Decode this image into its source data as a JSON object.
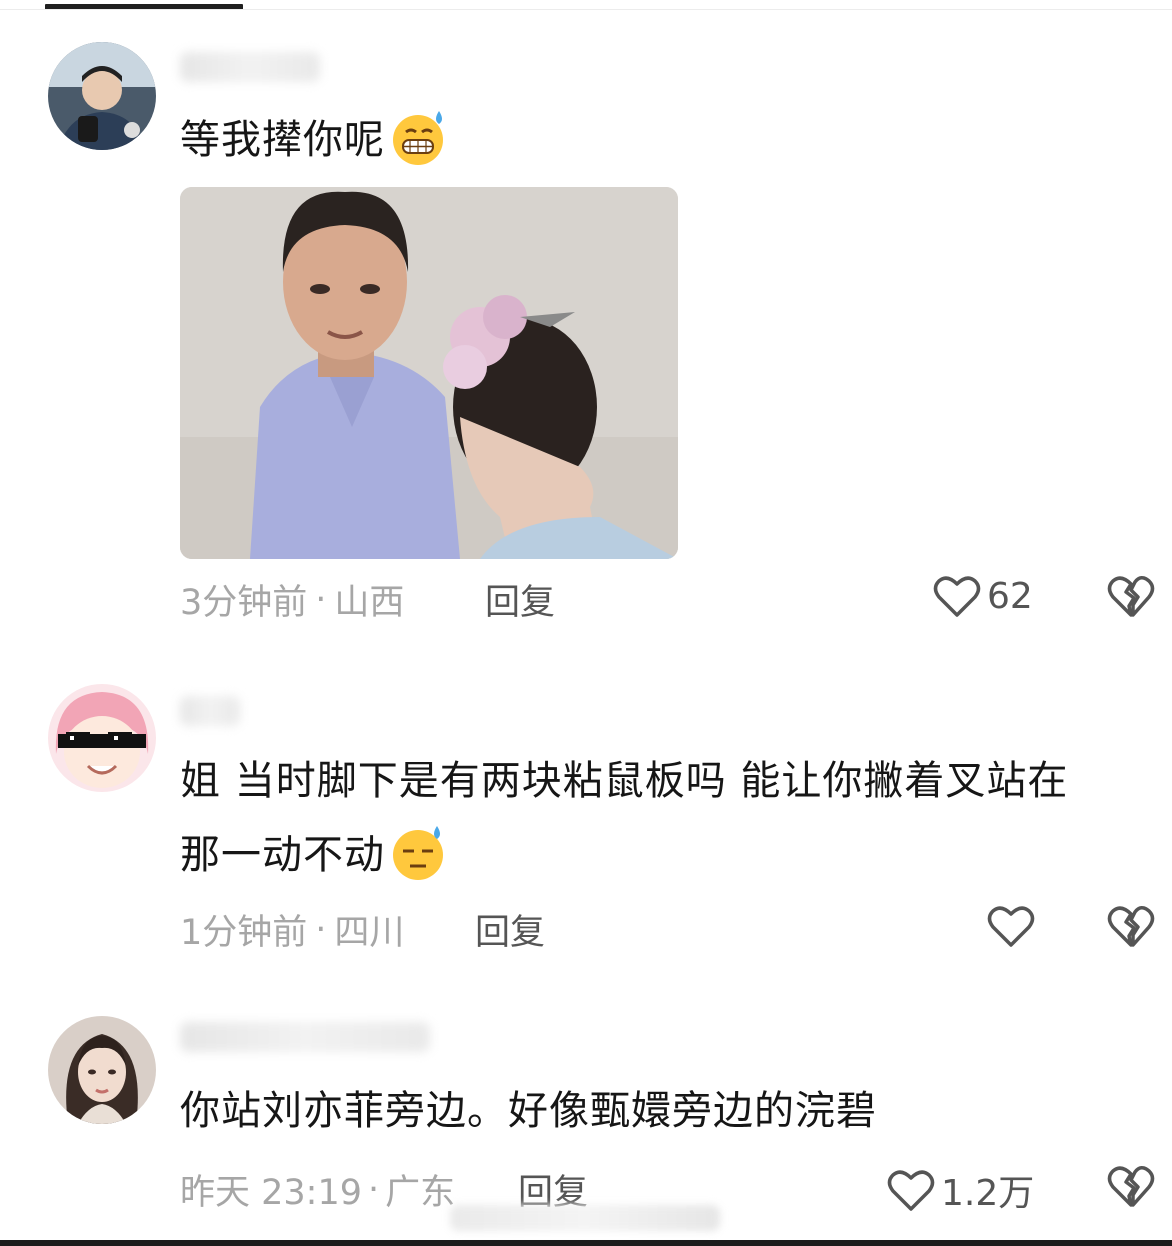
{
  "comments": [
    {
      "text": "等我撵你呢",
      "emoji": "grimace-sweat-emoji",
      "time": "3分钟前",
      "location": "山西",
      "reply_label": "回复",
      "likes": "62"
    },
    {
      "text_line1": "姐 当时脚下是有两块粘鼠板吗 能让你撇着叉站在",
      "text_line2": "那一动不动",
      "emoji": "downcast-sweat-emoji",
      "time": "1分钟前",
      "location": "四川",
      "reply_label": "回复",
      "likes": ""
    },
    {
      "text": "你站刘亦菲旁边。好像甄嬛旁边的浣碧",
      "time": "昨天 23:19",
      "location": "广东",
      "reply_label": "回复",
      "likes": "1.2万"
    }
  ],
  "meta_separator": "·",
  "colors": {
    "text": "#161616",
    "meta": "#a6a6a6",
    "reply": "#555555",
    "icon": "#555555",
    "emoji_face": "#ffc83d",
    "sweat": "#4aa8e8"
  }
}
